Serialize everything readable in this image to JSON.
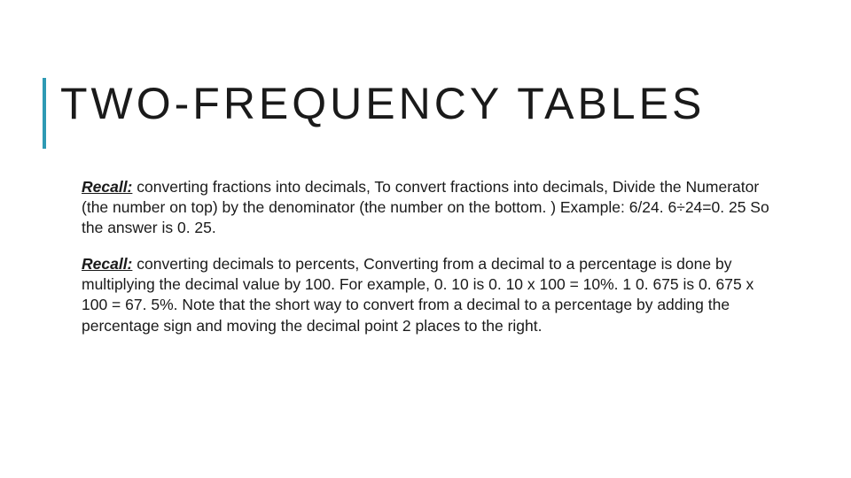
{
  "title": "TWO-FREQUENCY TABLES",
  "accent_color": "#2e9ab4",
  "paragraphs": [
    {
      "label": "Recall:",
      "text": " converting fractions into decimals, To convert fractions into decimals, Divide the Numerator (the number on top) by the denominator (the number on the bottom. ) Example: 6/24. 6÷24=0. 25 So the answer is 0. 25."
    },
    {
      "label": "Recall:",
      "text": " converting decimals to percents, Converting from a decimal to a percentage is done by multiplying the decimal value by 100. For example, 0. 10 is 0. 10 x 100 = 10%. 1 0. 675 is 0. 675 x 100 = 67. 5%. Note that the short way to convert from a decimal to a percentage by adding the percentage sign and moving the decimal point 2 places to the right."
    }
  ]
}
